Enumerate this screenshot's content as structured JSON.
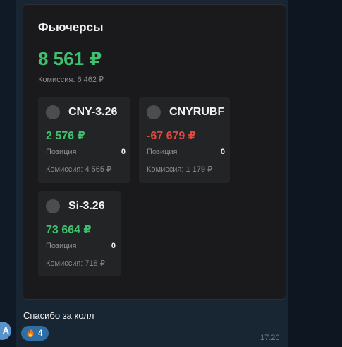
{
  "avatar": {
    "initial": "A"
  },
  "card": {
    "title": "Фьючерсы",
    "total_value": "8 561 ₽",
    "total_commission": "Комиссия: 6 462 ₽",
    "tiles": [
      {
        "name": "CNY-3.26",
        "pnl": "2 576 ₽",
        "pnl_sign": "positive",
        "position_label": "Позиция",
        "position_value": "0",
        "commission": "Комиссия: 4 565 ₽"
      },
      {
        "name": "CNYRUBF",
        "pnl": "-67 679 ₽",
        "pnl_sign": "negative",
        "position_label": "Позиция",
        "position_value": "0",
        "commission": "Комиссия: 1 179 ₽"
      },
      {
        "name": "Si-3.26",
        "pnl": "73 664 ₽",
        "pnl_sign": "positive",
        "position_label": "Позиция",
        "position_value": "0",
        "commission": "Комиссия: 718 ₽"
      }
    ]
  },
  "message": {
    "text": "Спасибо за колл",
    "reaction": {
      "icon": "fire-icon",
      "count": "4"
    },
    "time": "17:20"
  },
  "colors": {
    "positive": "#3fc06e",
    "negative": "#e0483e",
    "reaction_bg": "#2f6ea5"
  }
}
